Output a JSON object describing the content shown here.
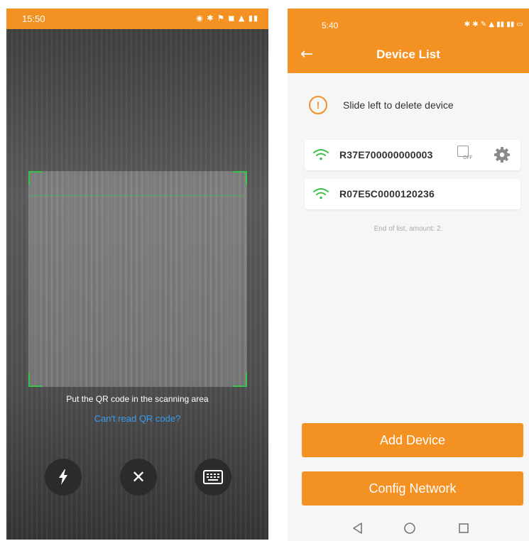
{
  "scanner": {
    "status_time": "15:50",
    "hint_text": "Put the QR code in the scanning area",
    "cant_read_text": "Can't read QR code?",
    "accent_color": "#f39122",
    "frame_color": "#39c24f",
    "buttons": {
      "flash_icon": "flash-icon",
      "close_icon": "close-icon",
      "close_glyph": "✕",
      "keyboard_icon": "keyboard-icon"
    }
  },
  "device_list": {
    "status_time": "5:40",
    "back_glyph": "←",
    "title": "Device List",
    "tip": {
      "icon_glyph": "!",
      "text": "Slide left to delete device"
    },
    "devices": [
      {
        "id": "R37E700000000003",
        "wifi_icon": "wifi-icon",
        "sim_label": "OFF",
        "has_settings": true
      },
      {
        "id": "R07E5C0000120236",
        "wifi_icon": "wifi-icon",
        "has_settings": false
      }
    ],
    "end_text": "End of list, amount: 2.",
    "add_device_label": "Add Device",
    "config_network_label": "Config Network",
    "accent_color": "#f39122",
    "wifi_color": "#3bbf4a"
  }
}
